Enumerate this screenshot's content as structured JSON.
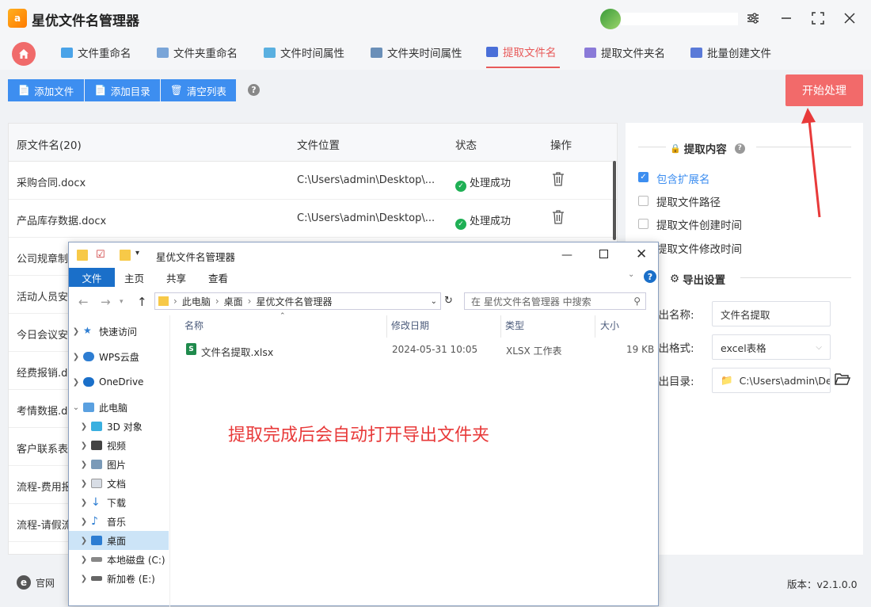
{
  "app": {
    "title": "星优文件名管理器",
    "logo_text": "a"
  },
  "tabs": [
    {
      "label": "文件重命名",
      "icon_color": "#4aa3e8"
    },
    {
      "label": "文件夹重命名",
      "icon_color": "#7aa5d8"
    },
    {
      "label": "文件时间属性",
      "icon_color": "#5ab0e0"
    },
    {
      "label": "文件夹时间属性",
      "icon_color": "#6a8fb8"
    },
    {
      "label": "提取文件名",
      "icon_color": "#4a6fd8"
    },
    {
      "label": "提取文件夹名",
      "icon_color": "#8a7ad8"
    },
    {
      "label": "批量创建文件",
      "icon_color": "#5a7ad8"
    }
  ],
  "toolbar": {
    "add_file": "添加文件",
    "add_dir": "添加目录",
    "clear_list": "清空列表",
    "help": "?",
    "start": "开始处理"
  },
  "table": {
    "headers": {
      "name": "原文件名(20)",
      "location": "文件位置",
      "status": "状态",
      "action": "操作"
    },
    "rows": [
      {
        "name": "采购合同.docx",
        "location": "C:\\Users\\admin\\Desktop\\...",
        "status": "处理成功"
      },
      {
        "name": "产品库存数据.docx",
        "location": "C:\\Users\\admin\\Desktop\\...",
        "status": "处理成功"
      },
      {
        "name": "公司规章制",
        "location": "",
        "status": ""
      },
      {
        "name": "活动人员安",
        "location": "",
        "status": ""
      },
      {
        "name": "今日会议安",
        "location": "",
        "status": ""
      },
      {
        "name": "经费报销.d",
        "location": "",
        "status": ""
      },
      {
        "name": "考情数据.d",
        "location": "",
        "status": ""
      },
      {
        "name": "客户联系表",
        "location": "",
        "status": ""
      },
      {
        "name": "流程-费用报",
        "location": "",
        "status": ""
      },
      {
        "name": "流程-请假流",
        "location": "",
        "status": ""
      }
    ]
  },
  "right_panel": {
    "extract_title": "提取内容",
    "options": [
      {
        "label": "包含扩展名",
        "checked": true
      },
      {
        "label": "提取文件路径",
        "checked": false
      },
      {
        "label": "提取文件创建时间",
        "checked": false
      },
      {
        "label": "提取文件修改时间",
        "checked": false
      }
    ],
    "export_title": "导出设置",
    "export_name_label": "导出名称:",
    "export_name_value": "文件名提取",
    "export_format_label": "导出格式:",
    "export_format_value": "excel表格",
    "export_dir_label": "导出目录:",
    "export_dir_value": "C:\\Users\\admin\\Des"
  },
  "bottom": {
    "website": "官网",
    "version": "版本：v2.1.0.0"
  },
  "explorer": {
    "title": "星优文件名管理器",
    "ribbon": [
      "文件",
      "主页",
      "共享",
      "查看"
    ],
    "path": [
      "此电脑",
      "桌面",
      "星优文件名管理器"
    ],
    "search_placeholder": "在 星优文件名管理器 中搜索",
    "nav": [
      {
        "label": "快速访问",
        "level": 0,
        "icon": "star-icon"
      },
      {
        "label": "WPS云盘",
        "level": 0,
        "icon": "cloud-icon"
      },
      {
        "label": "OneDrive",
        "level": 0,
        "icon": "cloud-icon"
      },
      {
        "label": "此电脑",
        "level": 0,
        "icon": "pc-icon"
      },
      {
        "label": "3D 对象",
        "level": 1,
        "icon": "cube-icon"
      },
      {
        "label": "视频",
        "level": 1,
        "icon": "video-icon"
      },
      {
        "label": "图片",
        "level": 1,
        "icon": "picture-icon"
      },
      {
        "label": "文档",
        "level": 1,
        "icon": "document-icon"
      },
      {
        "label": "下载",
        "level": 1,
        "icon": "download-icon"
      },
      {
        "label": "音乐",
        "level": 1,
        "icon": "music-icon"
      },
      {
        "label": "桌面",
        "level": 1,
        "icon": "desktop-icon"
      },
      {
        "label": "本地磁盘 (C:)",
        "level": 1,
        "icon": "disk-icon"
      },
      {
        "label": "新加卷 (E:)",
        "level": 1,
        "icon": "disk-icon"
      }
    ],
    "columns": {
      "name": "名称",
      "date": "修改日期",
      "type": "类型",
      "size": "大小"
    },
    "file": {
      "name": "文件名提取.xlsx",
      "date": "2024-05-31 10:05",
      "type": "XLSX 工作表",
      "size": "19 KB"
    }
  },
  "annotation": "提取完成后会自动打开导出文件夹"
}
